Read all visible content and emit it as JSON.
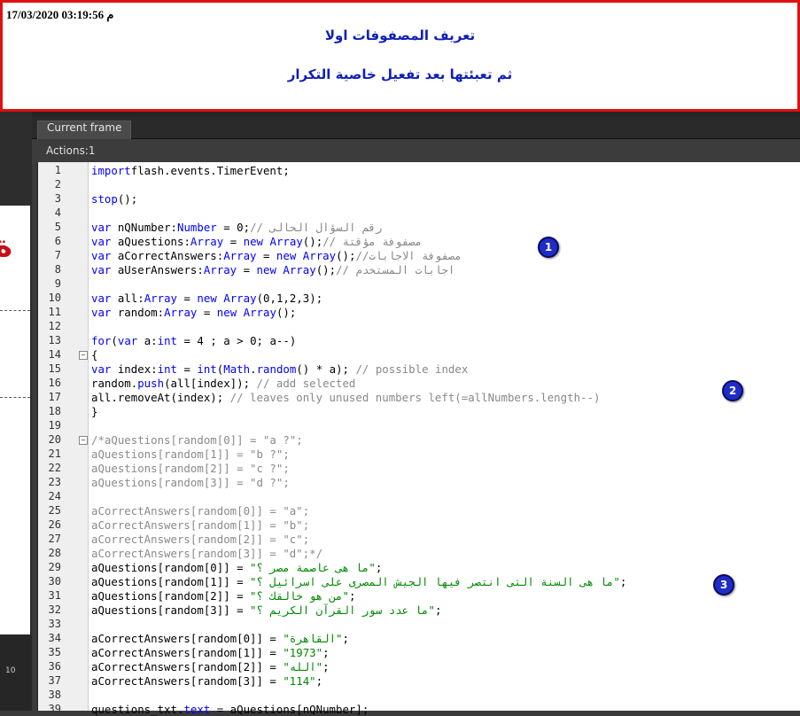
{
  "banner": {
    "timestamp": "17/03/2020 03:19:56 م",
    "line1": "تعريف المصفوفات اولا",
    "line2": "ثم  تعبئتها   بعد تفعيل خاصية التكرار"
  },
  "left_pane": {
    "stage_text": "ة",
    "timeline_number": "10"
  },
  "panel": {
    "title": "Actions",
    "tab_label": "Current frame",
    "breadcrumb": "Actions:1"
  },
  "badges": [
    "1",
    "2",
    "3"
  ],
  "code_lines": [
    {
      "n": "1",
      "parts": [
        [
          "kw",
          "import"
        ],
        [
          "",
          "flash.events.TimerEvent;"
        ]
      ]
    },
    {
      "n": "2",
      "parts": []
    },
    {
      "n": "3",
      "parts": [
        [
          "kw",
          "stop"
        ],
        [
          "",
          "();"
        ]
      ]
    },
    {
      "n": "4",
      "parts": []
    },
    {
      "n": "5",
      "parts": [
        [
          "kw",
          "var"
        ],
        [
          "",
          " nQNumber:"
        ],
        [
          "ty",
          "Number"
        ],
        [
          "",
          " = 0;"
        ],
        [
          "cm",
          "// رقم السؤال الحالى"
        ]
      ]
    },
    {
      "n": "6",
      "parts": [
        [
          "kw",
          "var"
        ],
        [
          "",
          " aQuestions:"
        ],
        [
          "ty",
          "Array"
        ],
        [
          "",
          " = "
        ],
        [
          "kw",
          "new"
        ],
        [
          "",
          " "
        ],
        [
          "ty",
          "Array"
        ],
        [
          "",
          "();"
        ],
        [
          "cm",
          "// مصفوفة مؤقتة"
        ]
      ]
    },
    {
      "n": "7",
      "parts": [
        [
          "kw",
          "var"
        ],
        [
          "",
          " aCorrectAnswers:"
        ],
        [
          "ty",
          "Array"
        ],
        [
          "",
          " = "
        ],
        [
          "kw",
          "new"
        ],
        [
          "",
          " "
        ],
        [
          "ty",
          "Array"
        ],
        [
          "",
          "();"
        ],
        [
          "cm",
          "//مصفوفة الاجابات"
        ]
      ]
    },
    {
      "n": "8",
      "parts": [
        [
          "kw",
          "var"
        ],
        [
          "",
          " aUserAnswers:"
        ],
        [
          "ty",
          "Array"
        ],
        [
          "",
          " = "
        ],
        [
          "kw",
          "new"
        ],
        [
          "",
          " "
        ],
        [
          "ty",
          "Array"
        ],
        [
          "",
          "();"
        ],
        [
          "cm",
          "// اجابات المستخدم"
        ]
      ]
    },
    {
      "n": "9",
      "parts": []
    },
    {
      "n": "10",
      "parts": [
        [
          "kw",
          "var"
        ],
        [
          "",
          " all:"
        ],
        [
          "ty",
          "Array"
        ],
        [
          "",
          " = "
        ],
        [
          "kw",
          "new"
        ],
        [
          "",
          " "
        ],
        [
          "ty",
          "Array"
        ],
        [
          "",
          "(0,1,2,3);"
        ]
      ]
    },
    {
      "n": "11",
      "parts": [
        [
          "kw",
          "var"
        ],
        [
          "",
          " random:"
        ],
        [
          "ty",
          "Array"
        ],
        [
          "",
          " = "
        ],
        [
          "kw",
          "new"
        ],
        [
          "",
          " "
        ],
        [
          "ty",
          "Array"
        ],
        [
          "",
          "();"
        ]
      ]
    },
    {
      "n": "12",
      "parts": []
    },
    {
      "n": "13",
      "parts": [
        [
          "kw",
          "for"
        ],
        [
          "",
          "("
        ],
        [
          "kw",
          "var"
        ],
        [
          "",
          " a:"
        ],
        [
          "ty",
          "int"
        ],
        [
          "",
          " = 4 ; a > 0; a--)"
        ]
      ]
    },
    {
      "n": "14",
      "parts": [
        [
          "",
          "{"
        ]
      ]
    },
    {
      "n": "15",
      "parts": [
        [
          "kw",
          "var"
        ],
        [
          "",
          " index:"
        ],
        [
          "ty",
          "int"
        ],
        [
          "",
          " = "
        ],
        [
          "ty",
          "int"
        ],
        [
          "",
          "("
        ],
        [
          "ty",
          "Math"
        ],
        [
          "",
          "."
        ],
        [
          "kw",
          "random"
        ],
        [
          "",
          "() * a); "
        ],
        [
          "cm",
          "// possible index"
        ]
      ]
    },
    {
      "n": "16",
      "parts": [
        [
          "",
          "random."
        ],
        [
          "kw",
          "push"
        ],
        [
          "",
          "(all[index]); "
        ],
        [
          "cm",
          "// add selected"
        ]
      ]
    },
    {
      "n": "17",
      "parts": [
        [
          "",
          "all.removeAt(index); "
        ],
        [
          "cm",
          "// leaves only unused numbers left(=allNumbers.length--)"
        ]
      ]
    },
    {
      "n": "18",
      "parts": [
        [
          "",
          "}"
        ]
      ]
    },
    {
      "n": "19",
      "parts": []
    },
    {
      "n": "20",
      "parts": [
        [
          "gr",
          "/*aQuestions[random[0]] = \"a ?\";"
        ]
      ]
    },
    {
      "n": "21",
      "parts": [
        [
          "gr",
          "aQuestions[random[1]] = \"b ?\";"
        ]
      ]
    },
    {
      "n": "22",
      "parts": [
        [
          "gr",
          "aQuestions[random[2]] = \"c ?\";"
        ]
      ]
    },
    {
      "n": "23",
      "parts": [
        [
          "gr",
          "aQuestions[random[3]] = \"d ?\";"
        ]
      ]
    },
    {
      "n": "24",
      "parts": []
    },
    {
      "n": "25",
      "parts": [
        [
          "gr",
          "aCorrectAnswers[random[0]] = \"a\";"
        ]
      ]
    },
    {
      "n": "26",
      "parts": [
        [
          "gr",
          "aCorrectAnswers[random[1]] = \"b\";"
        ]
      ]
    },
    {
      "n": "27",
      "parts": [
        [
          "gr",
          "aCorrectAnswers[random[2]] = \"c\";"
        ]
      ]
    },
    {
      "n": "28",
      "parts": [
        [
          "gr",
          "aCorrectAnswers[random[3]] = \"d\";*/"
        ]
      ]
    },
    {
      "n": "29",
      "parts": [
        [
          "",
          "aQuestions[random[0]] = "
        ],
        [
          "st",
          "\"ما هى عاصمة مصر ؟\""
        ],
        [
          "",
          ";"
        ]
      ]
    },
    {
      "n": "30",
      "parts": [
        [
          "",
          "aQuestions[random[1]] = "
        ],
        [
          "st",
          "\"ما هى السنة التى انتصر فيها الجيش المصرى على اسرائيل ؟\""
        ],
        [
          "",
          ";"
        ]
      ]
    },
    {
      "n": "31",
      "parts": [
        [
          "",
          "aQuestions[random[2]] = "
        ],
        [
          "st",
          "\"من هو خالقك ؟\""
        ],
        [
          "",
          ";"
        ]
      ]
    },
    {
      "n": "32",
      "parts": [
        [
          "",
          "aQuestions[random[3]] = "
        ],
        [
          "st",
          "\"ما عدد سور القرآن الكريم ؟\""
        ],
        [
          "",
          ";"
        ]
      ]
    },
    {
      "n": "33",
      "parts": []
    },
    {
      "n": "34",
      "parts": [
        [
          "",
          "aCorrectAnswers[random[0]] = "
        ],
        [
          "st",
          "\"القاهرة\""
        ],
        [
          "",
          ";"
        ]
      ]
    },
    {
      "n": "35",
      "parts": [
        [
          "",
          "aCorrectAnswers[random[1]] = "
        ],
        [
          "st",
          "\"1973\""
        ],
        [
          "",
          ";"
        ]
      ]
    },
    {
      "n": "36",
      "parts": [
        [
          "",
          "aCorrectAnswers[random[2]] = "
        ],
        [
          "st",
          "\"الله\""
        ],
        [
          "",
          ";"
        ]
      ]
    },
    {
      "n": "37",
      "parts": [
        [
          "",
          "aCorrectAnswers[random[3]] = "
        ],
        [
          "st",
          "\"114\""
        ],
        [
          "",
          ";"
        ]
      ]
    },
    {
      "n": "38",
      "parts": []
    },
    {
      "n": "39",
      "parts": [
        [
          "",
          "questions_txt."
        ],
        [
          "kw",
          "text"
        ],
        [
          "",
          " = aQuestions[nQNumber];"
        ]
      ]
    }
  ]
}
